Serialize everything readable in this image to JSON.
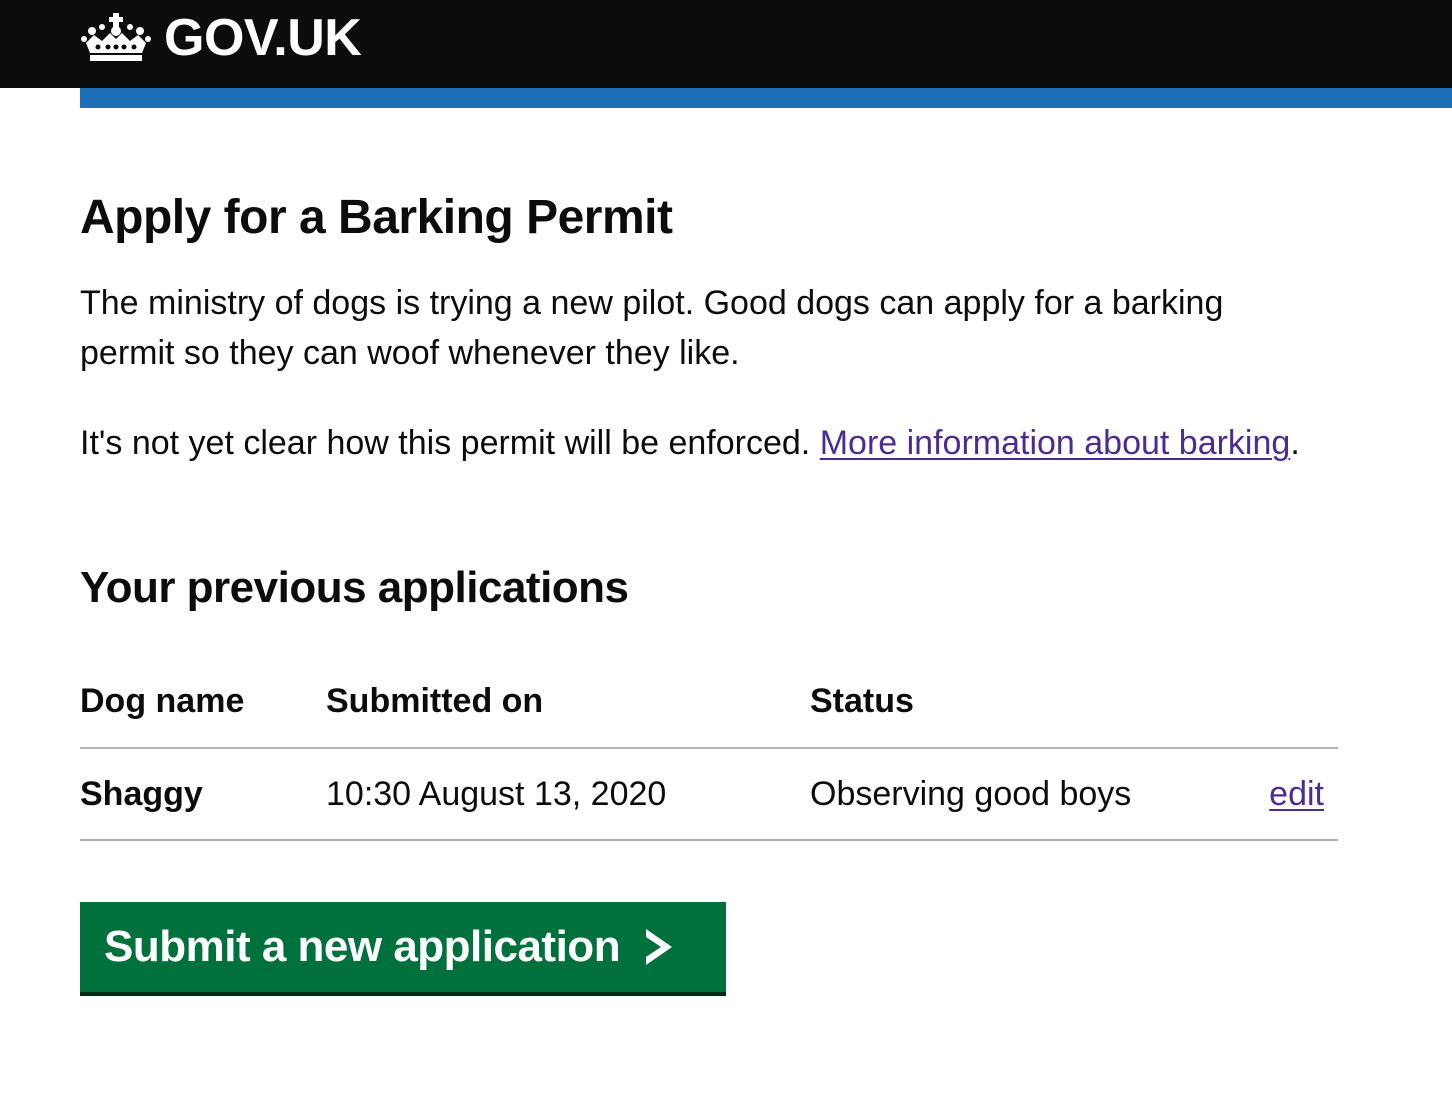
{
  "header": {
    "logo_text": "GOV.UK",
    "brand_color": "#0b0c0c",
    "accent_bar_color": "#1d70b8",
    "crown_icon": "crown-icon"
  },
  "main": {
    "title": "Apply for a Barking Permit",
    "intro": "The ministry of dogs is trying a new pilot. Good dogs can apply for a barking permit so they can woof whenever they like.",
    "enforcement_text": "It's not yet clear how this permit will be enforced.",
    "more_info_link": "More information about barking",
    "enforcement_suffix": ".",
    "previous_heading": "Your previous applications",
    "table": {
      "headers": [
        "Dog name",
        "Submitted on",
        "Status"
      ],
      "rows": [
        {
          "dog_name": "Shaggy",
          "submitted_on": "10:30 August 13, 2020",
          "status": "Observing good boys",
          "action": "edit"
        }
      ]
    },
    "submit_button": {
      "label": "Submit a new application",
      "icon": "chevron-right-icon",
      "color": "#00703c"
    },
    "link_color": "#4c2c92"
  }
}
